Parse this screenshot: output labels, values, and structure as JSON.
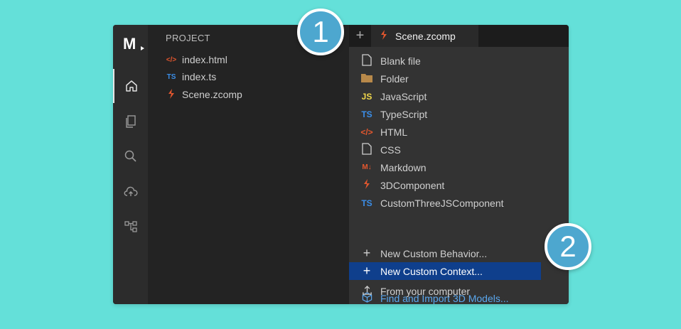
{
  "sidebar": {
    "logo": "M",
    "icons": [
      "home-icon",
      "files-icon",
      "search-icon",
      "cloud-upload-icon",
      "hierarchy-icon"
    ]
  },
  "project": {
    "title": "PROJECT",
    "files": [
      {
        "icon": "</>",
        "name": "index.html"
      },
      {
        "icon": "TS",
        "name": "index.ts"
      },
      {
        "icon": "Z",
        "name": "Scene.zcomp"
      }
    ]
  },
  "tabs": {
    "plus": "+",
    "active_tab": "Scene.zcomp"
  },
  "menu": {
    "items": [
      {
        "icon": "file",
        "label": "Blank file"
      },
      {
        "icon": "folder",
        "label": "Folder"
      },
      {
        "icon": "JS",
        "label": "JavaScript"
      },
      {
        "icon": "TS",
        "label": "TypeScript"
      },
      {
        "icon": "</>",
        "label": "HTML"
      },
      {
        "icon": "file",
        "label": "CSS"
      },
      {
        "icon": "M↓",
        "label": "Markdown"
      },
      {
        "icon": "zapworks",
        "label": "3DComponent"
      },
      {
        "icon": "TS",
        "label": "CustomThreeJSComponent"
      },
      {
        "icon": "+",
        "label": "New Custom Behavior..."
      },
      {
        "icon": "+",
        "label": "New Custom Context..."
      },
      {
        "icon": "cube",
        "label": "Find and Import 3D Models..."
      },
      {
        "icon": "upload",
        "label": "From your computer"
      }
    ]
  },
  "callouts": [
    "1",
    "2"
  ],
  "colors": {
    "background": "#64e0d9",
    "selected": "#0f3f8c",
    "callout": "#4da7cf",
    "link": "#5aa7ee"
  }
}
